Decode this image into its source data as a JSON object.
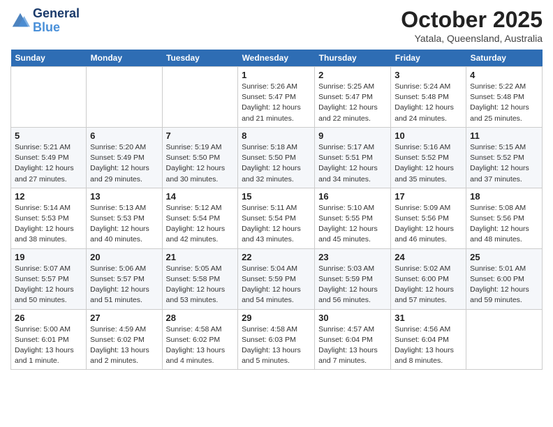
{
  "header": {
    "logo_line1": "General",
    "logo_line2": "Blue",
    "month": "October 2025",
    "location": "Yatala, Queensland, Australia"
  },
  "weekdays": [
    "Sunday",
    "Monday",
    "Tuesday",
    "Wednesday",
    "Thursday",
    "Friday",
    "Saturday"
  ],
  "weeks": [
    [
      {
        "day": "",
        "info": ""
      },
      {
        "day": "",
        "info": ""
      },
      {
        "day": "",
        "info": ""
      },
      {
        "day": "1",
        "info": "Sunrise: 5:26 AM\nSunset: 5:47 PM\nDaylight: 12 hours\nand 21 minutes."
      },
      {
        "day": "2",
        "info": "Sunrise: 5:25 AM\nSunset: 5:47 PM\nDaylight: 12 hours\nand 22 minutes."
      },
      {
        "day": "3",
        "info": "Sunrise: 5:24 AM\nSunset: 5:48 PM\nDaylight: 12 hours\nand 24 minutes."
      },
      {
        "day": "4",
        "info": "Sunrise: 5:22 AM\nSunset: 5:48 PM\nDaylight: 12 hours\nand 25 minutes."
      }
    ],
    [
      {
        "day": "5",
        "info": "Sunrise: 5:21 AM\nSunset: 5:49 PM\nDaylight: 12 hours\nand 27 minutes."
      },
      {
        "day": "6",
        "info": "Sunrise: 5:20 AM\nSunset: 5:49 PM\nDaylight: 12 hours\nand 29 minutes."
      },
      {
        "day": "7",
        "info": "Sunrise: 5:19 AM\nSunset: 5:50 PM\nDaylight: 12 hours\nand 30 minutes."
      },
      {
        "day": "8",
        "info": "Sunrise: 5:18 AM\nSunset: 5:50 PM\nDaylight: 12 hours\nand 32 minutes."
      },
      {
        "day": "9",
        "info": "Sunrise: 5:17 AM\nSunset: 5:51 PM\nDaylight: 12 hours\nand 34 minutes."
      },
      {
        "day": "10",
        "info": "Sunrise: 5:16 AM\nSunset: 5:52 PM\nDaylight: 12 hours\nand 35 minutes."
      },
      {
        "day": "11",
        "info": "Sunrise: 5:15 AM\nSunset: 5:52 PM\nDaylight: 12 hours\nand 37 minutes."
      }
    ],
    [
      {
        "day": "12",
        "info": "Sunrise: 5:14 AM\nSunset: 5:53 PM\nDaylight: 12 hours\nand 38 minutes."
      },
      {
        "day": "13",
        "info": "Sunrise: 5:13 AM\nSunset: 5:53 PM\nDaylight: 12 hours\nand 40 minutes."
      },
      {
        "day": "14",
        "info": "Sunrise: 5:12 AM\nSunset: 5:54 PM\nDaylight: 12 hours\nand 42 minutes."
      },
      {
        "day": "15",
        "info": "Sunrise: 5:11 AM\nSunset: 5:54 PM\nDaylight: 12 hours\nand 43 minutes."
      },
      {
        "day": "16",
        "info": "Sunrise: 5:10 AM\nSunset: 5:55 PM\nDaylight: 12 hours\nand 45 minutes."
      },
      {
        "day": "17",
        "info": "Sunrise: 5:09 AM\nSunset: 5:56 PM\nDaylight: 12 hours\nand 46 minutes."
      },
      {
        "day": "18",
        "info": "Sunrise: 5:08 AM\nSunset: 5:56 PM\nDaylight: 12 hours\nand 48 minutes."
      }
    ],
    [
      {
        "day": "19",
        "info": "Sunrise: 5:07 AM\nSunset: 5:57 PM\nDaylight: 12 hours\nand 50 minutes."
      },
      {
        "day": "20",
        "info": "Sunrise: 5:06 AM\nSunset: 5:57 PM\nDaylight: 12 hours\nand 51 minutes."
      },
      {
        "day": "21",
        "info": "Sunrise: 5:05 AM\nSunset: 5:58 PM\nDaylight: 12 hours\nand 53 minutes."
      },
      {
        "day": "22",
        "info": "Sunrise: 5:04 AM\nSunset: 5:59 PM\nDaylight: 12 hours\nand 54 minutes."
      },
      {
        "day": "23",
        "info": "Sunrise: 5:03 AM\nSunset: 5:59 PM\nDaylight: 12 hours\nand 56 minutes."
      },
      {
        "day": "24",
        "info": "Sunrise: 5:02 AM\nSunset: 6:00 PM\nDaylight: 12 hours\nand 57 minutes."
      },
      {
        "day": "25",
        "info": "Sunrise: 5:01 AM\nSunset: 6:00 PM\nDaylight: 12 hours\nand 59 minutes."
      }
    ],
    [
      {
        "day": "26",
        "info": "Sunrise: 5:00 AM\nSunset: 6:01 PM\nDaylight: 13 hours\nand 1 minute."
      },
      {
        "day": "27",
        "info": "Sunrise: 4:59 AM\nSunset: 6:02 PM\nDaylight: 13 hours\nand 2 minutes."
      },
      {
        "day": "28",
        "info": "Sunrise: 4:58 AM\nSunset: 6:02 PM\nDaylight: 13 hours\nand 4 minutes."
      },
      {
        "day": "29",
        "info": "Sunrise: 4:58 AM\nSunset: 6:03 PM\nDaylight: 13 hours\nand 5 minutes."
      },
      {
        "day": "30",
        "info": "Sunrise: 4:57 AM\nSunset: 6:04 PM\nDaylight: 13 hours\nand 7 minutes."
      },
      {
        "day": "31",
        "info": "Sunrise: 4:56 AM\nSunset: 6:04 PM\nDaylight: 13 hours\nand 8 minutes."
      },
      {
        "day": "",
        "info": ""
      }
    ]
  ]
}
